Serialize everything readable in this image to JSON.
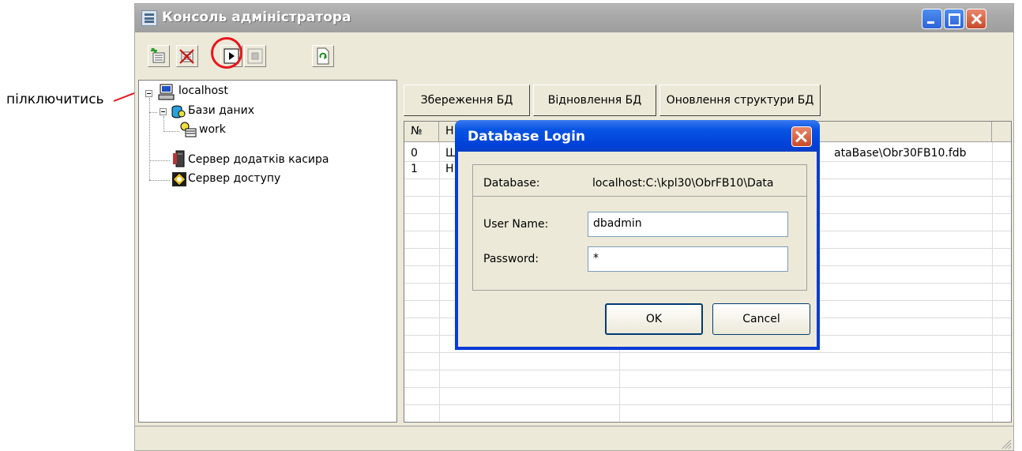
{
  "annotation": {
    "label": "пілключитись",
    "color": "#e8141c"
  },
  "window": {
    "title": "Консоль адміністратора",
    "icon": "console-app-icon"
  },
  "toolbar": {
    "buttons": [
      "add-icon",
      "delete-icon",
      "connect-icon",
      "disconnect-icon",
      "refresh-icon"
    ]
  },
  "tree": {
    "root": "localhost",
    "databases": "Бази даних",
    "db_work": "work",
    "cashier_server": "Сервер додатків касира",
    "access_server": "Сервер доступу"
  },
  "actions": {
    "backup": "Збереження БД",
    "restore": "Відновлення БД",
    "update_structure": "Оновлення структури БД"
  },
  "grid": {
    "columns": [
      "№",
      "Н"
    ],
    "rows": [
      {
        "num": "0",
        "name": "Ш",
        "path_tail": "ataBase\\Obr30FB10.fdb"
      },
      {
        "num": "1",
        "name": "Н",
        "path_tail": ""
      }
    ]
  },
  "dialog": {
    "title": "Database Login",
    "database_label": "Database:",
    "database_value": "localhost:C:\\kpl30\\ObrFB10\\Data",
    "username_label": "User Name:",
    "username_value": "dbadmin",
    "password_label": "Password:",
    "password_value": "*",
    "ok": "OK",
    "cancel": "Cancel"
  }
}
